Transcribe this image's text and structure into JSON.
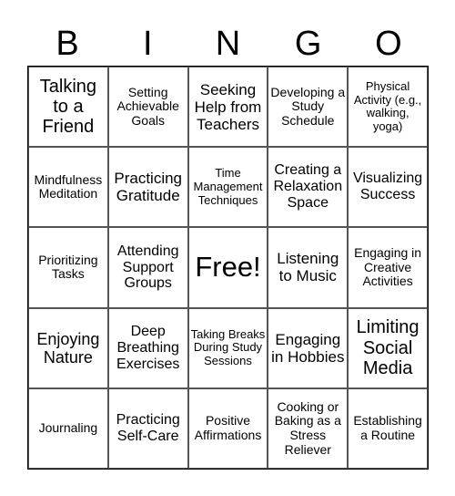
{
  "header": {
    "letters": [
      "B",
      "I",
      "N",
      "G",
      "O"
    ]
  },
  "board": {
    "rows": [
      [
        "Talking to a Friend",
        "Setting Achievable Goals",
        "Seeking Help from Teachers",
        "Developing a Study Schedule",
        "Physical Activity (e.g., walking, yoga)"
      ],
      [
        "Mindfulness Meditation",
        "Practicing Gratitude",
        "Time Management Techniques",
        "Creating a Relaxation Space",
        "Visualizing Success"
      ],
      [
        "Prioritizing Tasks",
        "Attending Support Groups",
        "Free!",
        "Listening to Music",
        "Engaging in Creative Activities"
      ],
      [
        "Enjoying Nature",
        "Deep Breathing Exercises",
        "Taking Breaks During Study Sessions",
        "Engaging in Hobbies",
        "Limiting Social Media"
      ],
      [
        "Journaling",
        "Practicing Self-Care",
        "Positive Affirmations",
        "Cooking or Baking as a Stress Reliever",
        "Establishing a Routine"
      ]
    ]
  }
}
